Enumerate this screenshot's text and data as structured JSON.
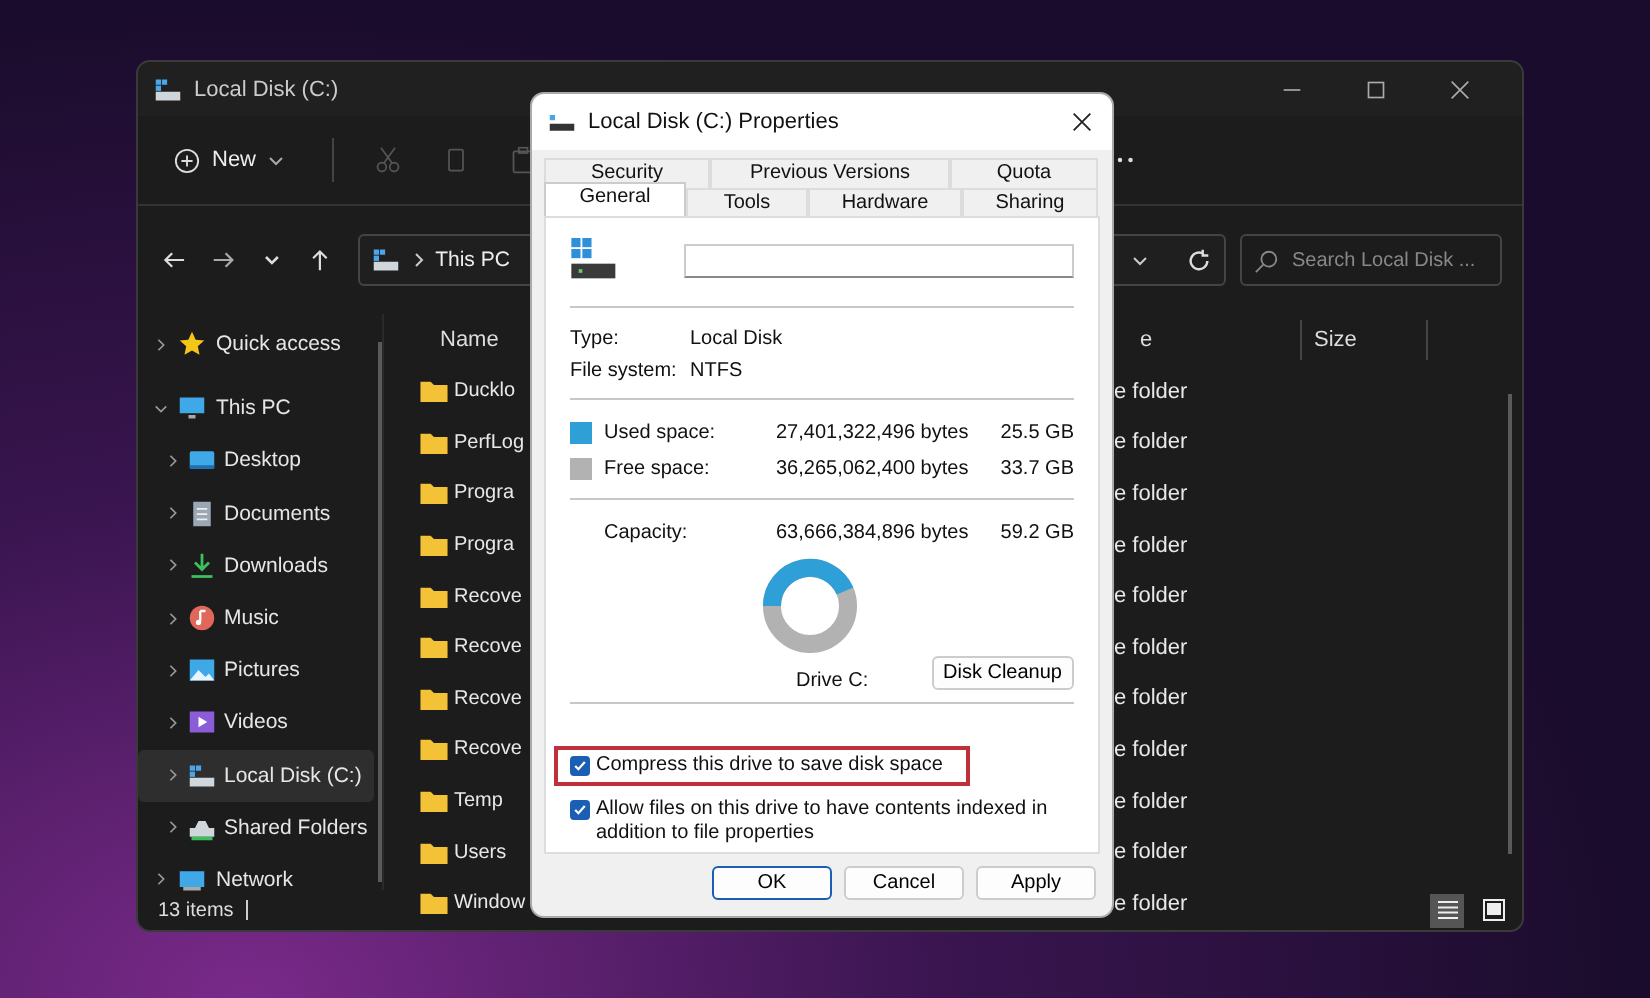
{
  "explorer": {
    "title": "Local Disk (C:)",
    "toolbar": {
      "new_label": "New"
    },
    "address": {
      "crumbs": [
        "This PC"
      ]
    },
    "search": {
      "placeholder": "Search Local Disk ..."
    },
    "sidebar": {
      "items": [
        {
          "label": "Quick access",
          "kind": "star",
          "expanded": false,
          "selected": false
        },
        {
          "label": "This PC",
          "kind": "pc",
          "expanded": true,
          "selected": false,
          "children": [
            {
              "label": "Desktop",
              "kind": "desktop",
              "expanded": false,
              "selected": false
            },
            {
              "label": "Documents",
              "kind": "documents",
              "expanded": false,
              "selected": false
            },
            {
              "label": "Downloads",
              "kind": "downloads",
              "expanded": false,
              "selected": false
            },
            {
              "label": "Music",
              "kind": "music",
              "expanded": false,
              "selected": false
            },
            {
              "label": "Pictures",
              "kind": "pictures",
              "expanded": false,
              "selected": false
            },
            {
              "label": "Videos",
              "kind": "videos",
              "expanded": false,
              "selected": false
            },
            {
              "label": "Local Disk (C:)",
              "kind": "drive",
              "expanded": false,
              "selected": true
            },
            {
              "label": "Shared Folders",
              "kind": "share",
              "expanded": false,
              "selected": false
            }
          ]
        },
        {
          "label": "Network",
          "kind": "network",
          "expanded": false,
          "selected": false
        }
      ]
    },
    "columns": {
      "name": "Name",
      "type": "e",
      "size": "Size"
    },
    "rows": [
      {
        "name": "Ducklo",
        "type": "e folder"
      },
      {
        "name": "PerfLog",
        "type": "e folder"
      },
      {
        "name": "Progra",
        "type": "e folder"
      },
      {
        "name": "Progra",
        "type": "e folder"
      },
      {
        "name": "Recove",
        "type": "e folder"
      },
      {
        "name": "Recove",
        "type": "e folder"
      },
      {
        "name": "Recove",
        "type": "e folder"
      },
      {
        "name": "Recove",
        "type": "e folder"
      },
      {
        "name": "Temp",
        "type": "e folder"
      },
      {
        "name": "Users",
        "type": "e folder"
      },
      {
        "name": "Window",
        "type": "e folder"
      }
    ],
    "status_bar": {
      "count": "13 items"
    },
    "views": [
      {
        "kind": "details",
        "selected": true
      },
      {
        "kind": "tiles",
        "selected": false
      }
    ]
  },
  "dialog": {
    "title": "Local Disk (C:) Properties",
    "tab_rows": [
      [
        {
          "label": "Security",
          "selected": false
        },
        {
          "label": "Previous Versions",
          "selected": false
        },
        {
          "label": "Quota",
          "selected": false
        }
      ],
      [
        {
          "label": "General",
          "selected": true
        },
        {
          "label": "Tools",
          "selected": false
        },
        {
          "label": "Hardware",
          "selected": false
        },
        {
          "label": "Sharing",
          "selected": false
        }
      ]
    ],
    "info": [
      {
        "label": "Type:",
        "value": "Local Disk"
      },
      {
        "label": "File system:",
        "value": "NTFS"
      }
    ],
    "space": [
      {
        "label": "Used space:",
        "bytes": "27,401,322,496 bytes",
        "size": "25.5 GB",
        "color": "#2f9fd8"
      },
      {
        "label": "Free space:",
        "bytes": "36,265,062,400 bytes",
        "size": "33.7 GB",
        "color": "#b2b2b2"
      }
    ],
    "capacity": {
      "label": "Capacity:",
      "bytes": "63,666,384,896 bytes",
      "size": "59.2 GB"
    },
    "drive_label": "Drive C:",
    "cleanup_button": "Disk Cleanup",
    "options": [
      {
        "label": "Compress this drive to save disk space",
        "checked": true,
        "highlighted": true
      },
      {
        "label": "Allow files on this drive to have contents indexed in addition to file properties",
        "checked": true,
        "highlighted": false
      }
    ],
    "buttons": [
      {
        "label": "OK",
        "default": true
      },
      {
        "label": "Cancel",
        "default": false
      },
      {
        "label": "Apply",
        "default": false
      }
    ]
  }
}
